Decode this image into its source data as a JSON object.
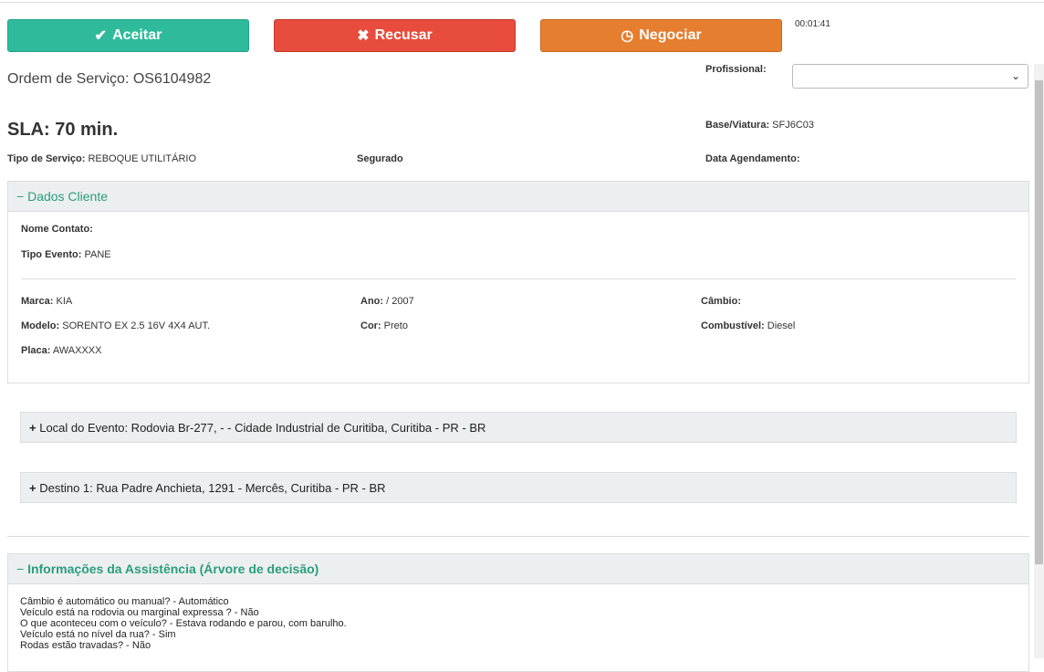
{
  "actions": {
    "accept": "Aceitar",
    "refuse": "Recusar",
    "negotiate": "Negociar",
    "timer": "00:01:41"
  },
  "header": {
    "order": "Ordem de Serviço: OS6104982",
    "sla": "SLA: 70 min.",
    "professional_label": "Profissional:",
    "professional_value": "",
    "base_label": "Base/Viatura:",
    "base_value": "SFJ6C03",
    "service_label": "Tipo de Serviço:",
    "service_value": "REBOQUE UTILITÁRIO",
    "insured_label": "Segurado",
    "schedule_label": "Data Agendamento:"
  },
  "client": {
    "title": "Dados Cliente",
    "contact_label": "Nome Contato:",
    "event_label": "Tipo Evento:",
    "event_value": "PANE",
    "brand_label": "Marca:",
    "brand_value": "KIA",
    "year_label": "Ano:",
    "year_value": "/ 2007",
    "gear_label": "Câmbio:",
    "model_label": "Modelo:",
    "model_value": "SORENTO EX 2.5 16V 4X4 AUT.",
    "color_label": "Cor:",
    "color_value": "Preto",
    "fuel_label": "Combustível:",
    "fuel_value": "Diesel",
    "plate_label": "Placa:",
    "plate_value": "AWAXXXX"
  },
  "location": "Local do Evento: Rodovia Br-277, - - Cidade Industrial de Curitiba, Curitiba - PR - BR",
  "destination": "Destino 1: Rua Padre Anchieta, 1291 - Mercês, Curitiba - PR - BR",
  "assistance": {
    "title": "Informações da Assistência (Árvore de decisão)",
    "lines": [
      "Câmbio é automático ou manual? - Automático",
      "Veículo está na rodovia ou marginal expressa ? - Não",
      "O que aconteceu com o veículo? - Estava rodando e parou, com barulho.",
      "Veículo está no nível da rua? - Sim",
      "Rodas estão travadas? - Não"
    ]
  }
}
